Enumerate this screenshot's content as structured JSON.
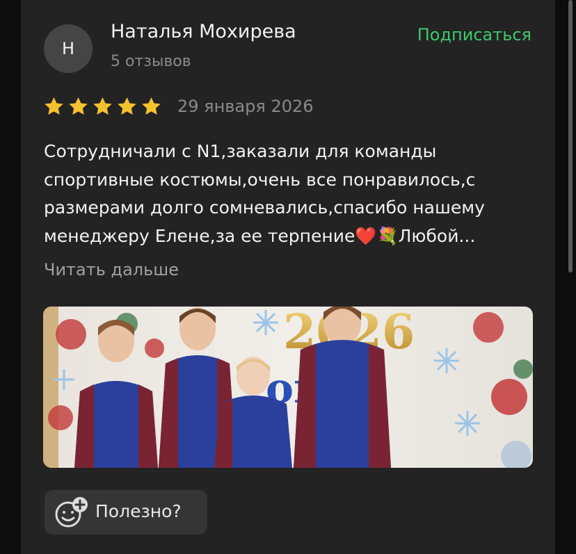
{
  "review": {
    "author": {
      "initial": "Н",
      "name": "Наталья Мохирева",
      "reviews_count": "5 отзывов"
    },
    "subscribe_label": "Подписаться",
    "rating": 5,
    "rating_max": 5,
    "date": "29 января 2026",
    "text_lines": [
      "Сотрудничали с N1,заказали для команды",
      "спортивные костюмы,очень все понравилось,с",
      "размерами долго сомневались,спасибо нашему",
      "менеджеру Елене,за ее терпение❤️💐Любой..."
    ],
    "read_more_label": "Читать дальше",
    "photo": {
      "banner_text_year": "2026",
      "banner_text_word": "ом"
    },
    "helpful_label": "Полезно?"
  },
  "colors": {
    "background": "#0d0d0d",
    "card": "#232323",
    "accent_green": "#3fc76d",
    "star": "#f5c12e",
    "text_primary": "#f2f2f2",
    "text_secondary": "#8a8a8a"
  },
  "icons": [
    "star-icon",
    "smile-plus-icon"
  ]
}
